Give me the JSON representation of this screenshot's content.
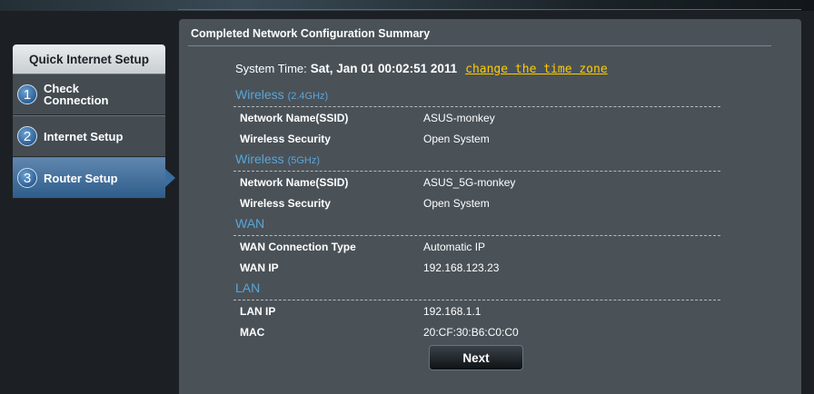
{
  "sidebar": {
    "header": "Quick Internet Setup",
    "items": [
      {
        "num": "1",
        "label": "Check\nConnection"
      },
      {
        "num": "2",
        "label": "Internet Setup"
      },
      {
        "num": "3",
        "label": "Router Setup"
      }
    ]
  },
  "panel": {
    "title": "Completed Network Configuration Summary",
    "system_time_label": "System Time:",
    "system_time_value": "Sat, Jan 01 00:02:51 2011",
    "change_tz_link": "change the time zone",
    "sections": {
      "wireless24": {
        "title": "Wireless",
        "sub": "(2.4GHz)",
        "rows": [
          {
            "k": "Network Name(SSID)",
            "v": "ASUS-monkey"
          },
          {
            "k": "Wireless Security",
            "v": "Open System"
          }
        ]
      },
      "wireless5": {
        "title": "Wireless",
        "sub": "(5GHz)",
        "rows": [
          {
            "k": "Network Name(SSID)",
            "v": "ASUS_5G-monkey"
          },
          {
            "k": "Wireless Security",
            "v": "Open System"
          }
        ]
      },
      "wan": {
        "title": "WAN",
        "rows": [
          {
            "k": "WAN Connection Type",
            "v": "Automatic IP"
          },
          {
            "k": "WAN IP",
            "v": "192.168.123.23"
          }
        ]
      },
      "lan": {
        "title": "LAN",
        "rows": [
          {
            "k": "LAN IP",
            "v": "192.168.1.1"
          },
          {
            "k": "MAC",
            "v": "20:CF:30:B6:C0:C0"
          }
        ]
      }
    },
    "next_label": "Next"
  },
  "colors": {
    "section_title": "#5aa5d9",
    "link": "#ffcc00",
    "active_item": "#3b6ea0",
    "panel_bg": "#4a5258"
  }
}
